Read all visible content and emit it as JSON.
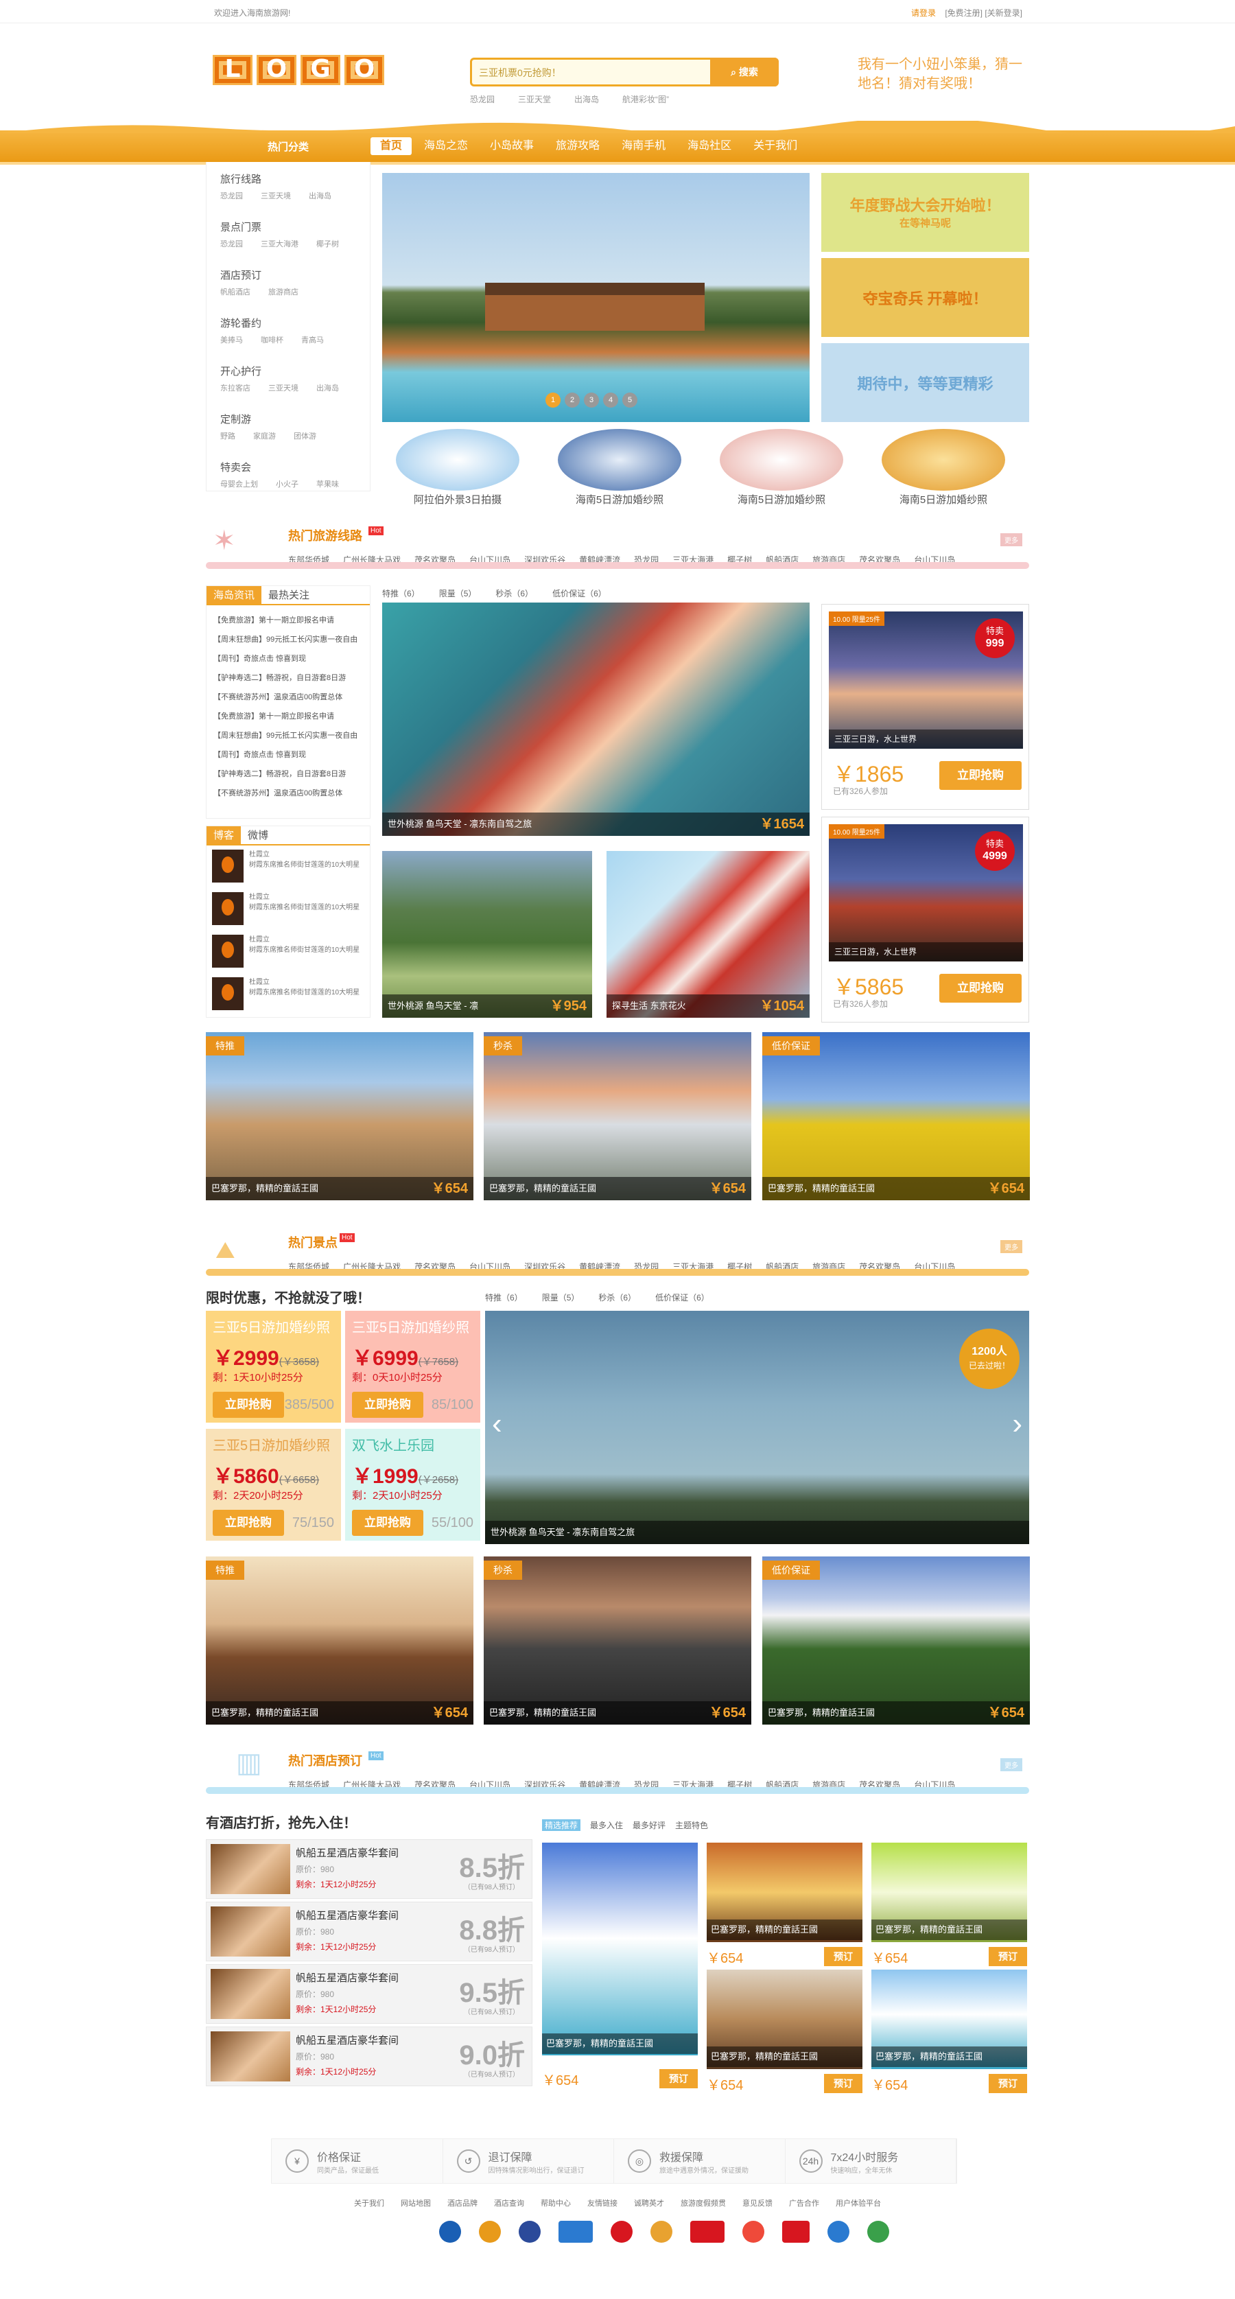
{
  "topbar": {
    "welcome": "欢迎进入海南旅游网!",
    "login": "请登录",
    "register": "[免费注册]",
    "collect": "[关新登录]"
  },
  "logo": [
    "L",
    "O",
    "G",
    "O"
  ],
  "search": {
    "placeholder": "三亚机票0元抢购！",
    "button": "搜索",
    "hot": [
      "恐龙园",
      "三亚天堂",
      "出海岛",
      "航港彩妆“图”"
    ]
  },
  "slogan": "我有一个小妞小笨巢，猜一地名！猜对有奖哦！",
  "nav": {
    "category": "热门分类",
    "items": [
      "首页",
      "海岛之恋",
      "小岛故事",
      "旅游攻略",
      "海南手机",
      "海岛社区",
      "关于我们"
    ]
  },
  "sidebar": [
    {
      "title": "旅行线路",
      "subs": [
        "恐龙园",
        "三亚天境",
        "出海岛"
      ]
    },
    {
      "title": "景点门票",
      "subs": [
        "恐龙园",
        "三亚大海港",
        "椰子树"
      ]
    },
    {
      "title": "酒店预订",
      "subs": [
        "帆船酒店",
        "旅游商店"
      ]
    },
    {
      "title": "游轮番约",
      "subs": [
        "美捧马",
        "咖啡杯",
        "青高马"
      ]
    },
    {
      "title": "开心护行",
      "subs": [
        "东拉客店",
        "三亚天境",
        "出海岛"
      ]
    },
    {
      "title": "定制游",
      "subs": [
        "野路",
        "家庭游",
        "团体游"
      ]
    },
    {
      "title": "特卖会",
      "subs": [
        "母婴会上划",
        "小火子",
        "苹果味"
      ]
    }
  ],
  "hero": {
    "dots": [
      "1",
      "2",
      "3",
      "4",
      "5"
    ]
  },
  "promos": [
    {
      "title": "年度野战大会开始啦！",
      "sub": "在等神马呢",
      "bg": "#dfe58a",
      "color": "#e8a230"
    },
    {
      "title": "夺宝奇兵 开幕啦！",
      "sub": "",
      "bg": "#ecc458",
      "color": "#e07b13"
    },
    {
      "title": "期待中，等等更精彩",
      "sub": "",
      "bg": "#c2ddf0",
      "color": "#6ea8d5"
    }
  ],
  "thumbs": [
    "阿拉伯外景3日拍摄",
    "海南5日游加婚纱照",
    "海南5日游加婚纱照",
    "海南5日游加婚纱照"
  ],
  "sec_routes": {
    "title": "热门旅游线路",
    "hot": "Hot",
    "more": "更多",
    "links": [
      "东部华侨城",
      "广州长隆大马戏",
      "茂名欢聚岛",
      "台山下川岛",
      "深圳欢乐谷",
      "黄鹤峡漂流",
      "恐龙园",
      "三亚大海港",
      "椰子树",
      "帆船酒店",
      "旅游商店",
      "茂名欢聚岛",
      "台山下川岛"
    ]
  },
  "news": {
    "tabs": [
      "海岛资讯",
      "最热关注"
    ],
    "items": [
      "【免费旅游】第十一期立即报名申请",
      "【周末狂想曲】99元抵工长闪实惠一夜自由",
      "【周刊】奇旅点击 惊喜到现",
      "【驴神寿选二】畅游祝，自日游套8日游",
      "【不赛统游苏州】温泉酒店00购置总体",
      "【免费旅游】第十一期立即报名申请",
      "【周末狂想曲】99元抵工长闪实惠一夜自由",
      "【周刊】奇旅点击 惊喜到现",
      "【驴神寿选二】畅游祝，自日游套8日游",
      "【不赛统游苏州】温泉酒店00购置总体"
    ]
  },
  "blog": {
    "tabs": [
      "博客",
      "微博"
    ],
    "user": "杜霞立",
    "text": "树霞东席推名师街甘莲莲的10大明星"
  },
  "filter1": [
    "特推（6）",
    "限量（5）",
    "秒杀（6）",
    "低价保证（6）"
  ],
  "feature": {
    "caption": "世外桃源 鱼鸟天堂 - 凛东南自驾之旅",
    "price": "￥1654"
  },
  "mid": [
    {
      "caption": "世外桃源 鱼鸟天堂 - 凛",
      "price": "￥954"
    },
    {
      "caption": "探寻生活 东京花火",
      "price": "￥1054"
    }
  ],
  "deals": [
    {
      "tag": "10.00 限量25件",
      "badge_a": "特卖",
      "badge_b": "999",
      "loc": "三亚三日游，水上世界",
      "price": "￥1865",
      "old": "一",
      "join": "已有326人参加",
      "buy": "立即抢购"
    },
    {
      "tag": "10.00 限量25件",
      "badge_a": "特卖",
      "badge_b": "4999",
      "loc": "三亚三日游，水上世界",
      "price": "￥5865",
      "old": "一",
      "join": "已有326人参加",
      "buy": "立即抢购"
    }
  ],
  "cards1": [
    {
      "label": "特推",
      "caption": "巴塞罗那，精精的童話王國",
      "price": "￥654"
    },
    {
      "label": "秒杀",
      "caption": "巴塞罗那，精精的童話王國",
      "price": "￥654"
    },
    {
      "label": "低价保证",
      "caption": "巴塞罗那，精精的童話王國",
      "price": "￥654"
    }
  ],
  "sec_spots": {
    "title": "热门景点",
    "hot": "Hot",
    "more": "更多",
    "links": [
      "东部华侨城",
      "广州长隆大马戏",
      "茂名欢聚岛",
      "台山下川岛",
      "深圳欢乐谷",
      "黄鹤峡漂流",
      "恐龙园",
      "三亚大海港",
      "椰子树",
      "帆船酒店",
      "旅游商店",
      "茂名欢聚岛",
      "台山下川岛"
    ]
  },
  "limited": {
    "heading": "限时优惠，不抢就没了哦！",
    "filter": [
      "特推（6）",
      "限量（5）",
      "秒杀（6）",
      "低价保证（6）"
    ]
  },
  "sales": [
    {
      "title": "三亚5日游加婚纱照",
      "price": "￥2999",
      "old": "(￥3658)",
      "rest": "剩：1天10小时25分",
      "buy": "立即抢购",
      "num": "385/500",
      "bg": "#fdd680",
      "tc": "#fff"
    },
    {
      "title": "三亚5日游加婚纱照",
      "price": "￥6999",
      "old": "(￥7658)",
      "rest": "剩：0天10小时25分",
      "buy": "立即抢购",
      "num": "85/100",
      "bg": "#fdbfb3",
      "tc": "#fff"
    },
    {
      "title": "三亚5日游加婚纱照",
      "price": "￥5860",
      "old": "(￥6658)",
      "rest": "剩：2天20小时25分",
      "buy": "立即抢购",
      "num": "75/150",
      "bg": "#f9e2b8",
      "tc": "#e6a24a"
    },
    {
      "title": "双飞水上乐园",
      "price": "￥1999",
      "old": "(￥2658)",
      "rest": "剩：2天10小时25分",
      "buy": "立即抢购",
      "num": "55/100",
      "bg": "#d9f6f1",
      "tc": "#41bca6"
    }
  ],
  "slider": {
    "caption": "世外桃源 鱼鸟天堂 - 凛东南自驾之旅",
    "count": "1200人",
    "count_sub": "已去过啦！"
  },
  "cards2": [
    {
      "label": "特推",
      "caption": "巴塞罗那，精精的童話王國",
      "price": "￥654"
    },
    {
      "label": "秒杀",
      "caption": "巴塞罗那，精精的童話王國",
      "price": "￥654"
    },
    {
      "label": "低价保证",
      "caption": "巴塞罗那，精精的童話王國",
      "price": "￥654"
    }
  ],
  "sec_hotel": {
    "title": "热门酒店预订",
    "hot": "Hot",
    "more": "更多",
    "links": [
      "东部华侨城",
      "广州长隆大马戏",
      "茂名欢聚岛",
      "台山下川岛",
      "深圳欢乐谷",
      "黄鹤峡漂流",
      "恐龙园",
      "三亚大海港",
      "椰子树",
      "帆船酒店",
      "旅游商店",
      "茂名欢聚岛",
      "台山下川岛"
    ]
  },
  "hotel_heading": "有酒店打折，抢先入住！",
  "hotel_tabs": [
    "精选推荐",
    "最多入住",
    "最多好评",
    "主题特色"
  ],
  "hotels": [
    {
      "name": "帆船五星酒店豪华套间",
      "orig": "原价：980",
      "rest": "剩余：1天12小时25分",
      "disc": "8.5折",
      "sold": "（已有98人预订）"
    },
    {
      "name": "帆船五星酒店豪华套间",
      "orig": "原价：980",
      "rest": "剩余：1天12小时25分",
      "disc": "8.8折",
      "sold": "（已有98人预订）"
    },
    {
      "name": "帆船五星酒店豪华套间",
      "orig": "原价：980",
      "rest": "剩余：1天12小时25分",
      "disc": "9.5折",
      "sold": "（已有98人预订）"
    },
    {
      "name": "帆船五星酒店豪华套间",
      "orig": "原价：980",
      "rest": "剩余：1天12小时25分",
      "disc": "9.0折",
      "sold": "（已有98人预订）"
    }
  ],
  "hcards": [
    {
      "caption": "巴塞罗那，精精的童話王國",
      "price": "￥654",
      "buy": "预订"
    },
    {
      "caption": "巴塞罗那，精精的童話王國",
      "price": "￥654",
      "buy": "预订"
    },
    {
      "caption": "巴塞罗那，精精的童話王國",
      "price": "￥654",
      "buy": "预订"
    },
    {
      "caption": "巴塞罗那，精精的童話王國",
      "price": "￥654",
      "buy": "预订"
    },
    {
      "caption": "巴塞罗那，精精的童話王國",
      "price": "￥654",
      "buy": "预订"
    },
    {
      "caption": "巴塞罗那，精精的童話王國",
      "price": "￥654",
      "buy": "预订"
    }
  ],
  "guarantees": [
    {
      "icon": "¥",
      "title": "价格保证",
      "sub": "同类产品，保证最低"
    },
    {
      "icon": "↺",
      "title": "退订保障",
      "sub": "因特殊情况影响出行，保证退订"
    },
    {
      "icon": "◎",
      "title": "救援保障",
      "sub": "旅途中遇意外情况，保证援助"
    },
    {
      "icon": "24h",
      "title": "7x24小时服务",
      "sub": "快速响应，全年无休"
    }
  ],
  "footer": [
    "关于我们",
    "网站地图",
    "酒店品牌",
    "酒店查询",
    "帮助中心",
    "友情链接",
    "诚聘英才",
    "旅游度假频贯",
    "意见反馈",
    "广告合作",
    "用户体验平台"
  ],
  "colors": {
    "accent": "#f1a42b",
    "red": "#d7161f",
    "text": "#555555"
  }
}
